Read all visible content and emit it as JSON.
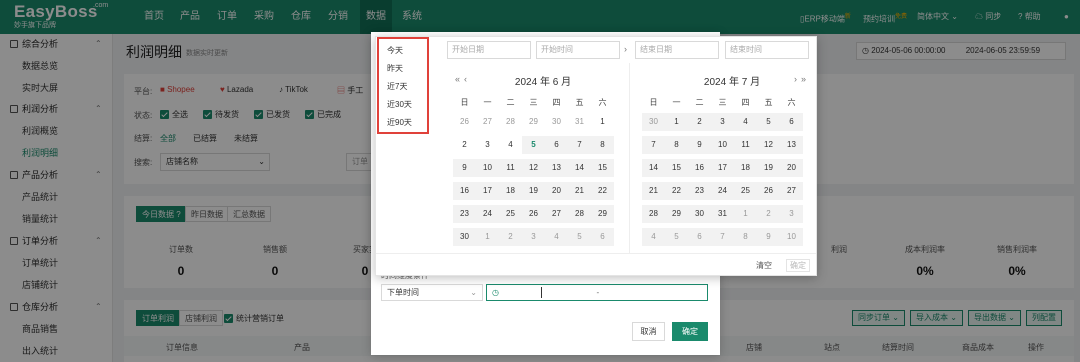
{
  "brand": {
    "name": "EasyBoss",
    "domain": ".com",
    "slogan": "妙手旗下品牌"
  },
  "nav": [
    {
      "label": "首页",
      "active": false
    },
    {
      "label": "产品",
      "active": false
    },
    {
      "label": "订单",
      "active": false
    },
    {
      "label": "采购",
      "active": false
    },
    {
      "label": "仓库",
      "active": false
    },
    {
      "label": "分销",
      "active": false
    },
    {
      "label": "数据",
      "active": true
    },
    {
      "label": "系统",
      "active": false
    }
  ],
  "topright": {
    "erp": "ERP移动端",
    "erp_badge": "新",
    "training": "预约培训",
    "training_badge": "免费",
    "lang": "简体中文",
    "sync": "同步",
    "help": "帮助"
  },
  "sidebar": {
    "groups": [
      {
        "label": "综合分析",
        "items": [
          "数据总览",
          "实时大屏"
        ]
      },
      {
        "label": "利润分析",
        "items": [
          "利润概览",
          "利润明细"
        ]
      },
      {
        "label": "产品分析",
        "items": [
          "产品统计",
          "销量统计"
        ]
      },
      {
        "label": "订单分析",
        "items": [
          "订单统计",
          "店铺统计"
        ]
      },
      {
        "label": "仓库分析",
        "items": [
          "商品销售",
          "出入统计"
        ]
      }
    ],
    "active_item": "利润明细"
  },
  "page": {
    "title": "利润明细",
    "subtitle": "数据实时更新"
  },
  "platforms": {
    "label": "平台:",
    "items": [
      "Shopee",
      "Lazada",
      "TikTok",
      "手工"
    ]
  },
  "status": {
    "label": "状态:",
    "items": [
      "全选",
      "待发货",
      "已发货",
      "已完成"
    ]
  },
  "settle": {
    "label": "结算:",
    "items": [
      "全部",
      "已结算",
      "未结算"
    ]
  },
  "search": {
    "label": "搜索:",
    "field": "店铺名称",
    "order_placeholder": "订单"
  },
  "daterange": {
    "start": "2024-05-06 00:00:00",
    "end": "2024-06-05 23:59:59"
  },
  "datatabs": [
    "今日数据",
    "昨日数据",
    "汇总数据"
  ],
  "stats": [
    {
      "label": "订单数",
      "value": "0"
    },
    {
      "label": "销售额",
      "value": "0"
    },
    {
      "label": "买家实",
      "value": "0"
    },
    {
      "label": "利润",
      "value": ""
    },
    {
      "label": "成本利润率",
      "value": "0%"
    },
    {
      "label": "销售利润率",
      "value": "0%"
    }
  ],
  "table": {
    "tabs": [
      "订单利润",
      "店铺利润"
    ],
    "checkbox": "统计营销订单",
    "buttons": [
      "同步订单",
      "导入成本",
      "导出数据",
      "列配置"
    ],
    "headers": [
      "订单信息",
      "产品",
      "店铺",
      "站点",
      "结算时间",
      "商品成本",
      "操作"
    ]
  },
  "picker": {
    "shortcuts": [
      "今天",
      "昨天",
      "近7天",
      "近30天",
      "近90天"
    ],
    "placeholders": {
      "start_date": "开始日期",
      "start_time": "开始时间",
      "end_date": "结束日期",
      "end_time": "结束时间"
    },
    "weekdays": [
      "日",
      "一",
      "二",
      "三",
      "四",
      "五",
      "六"
    ],
    "left": {
      "title": "2024 年 6 月",
      "days": [
        "26",
        "27",
        "28",
        "29",
        "30",
        "31",
        "1",
        "2",
        "3",
        "4",
        "5",
        "6",
        "7",
        "8",
        "9",
        "10",
        "11",
        "12",
        "13",
        "14",
        "15",
        "16",
        "17",
        "18",
        "19",
        "20",
        "21",
        "22",
        "23",
        "24",
        "25",
        "26",
        "27",
        "28",
        "29",
        "30",
        "1",
        "2",
        "3",
        "4",
        "5",
        "6"
      ],
      "first_current": 6,
      "last_current": 35,
      "today": "5"
    },
    "right": {
      "title": "2024 年 7 月",
      "days": [
        "30",
        "1",
        "2",
        "3",
        "4",
        "5",
        "6",
        "7",
        "8",
        "9",
        "10",
        "11",
        "12",
        "13",
        "14",
        "15",
        "16",
        "17",
        "18",
        "19",
        "20",
        "21",
        "22",
        "23",
        "24",
        "25",
        "26",
        "27",
        "28",
        "29",
        "30",
        "31",
        "1",
        "2",
        "3",
        "4",
        "5",
        "6",
        "7",
        "8",
        "9",
        "10"
      ],
      "first_current": 1,
      "last_current": 31
    },
    "clear": "清空",
    "ok": "确定"
  },
  "modal": {
    "condition_label": "时间维度条件",
    "type_select": "下单时间",
    "range_sep": "-",
    "cancel": "取消",
    "ok": "确定"
  }
}
